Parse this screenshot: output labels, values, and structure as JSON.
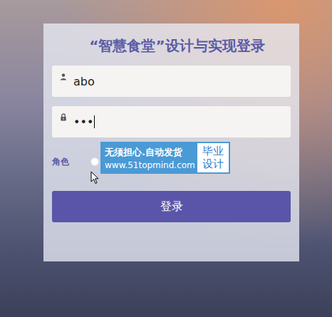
{
  "title": "“智慧食堂”设计与实现登录",
  "fields": [
    {
      "kind": "text",
      "value": "abo",
      "focused": false
    },
    {
      "kind": "password",
      "value": "•••",
      "focused": true
    }
  ],
  "role": {
    "label": "角色",
    "options": [
      {
        "selected": false
      }
    ]
  },
  "login_button": "登录",
  "watermark": {
    "line1": "无须担心.自动发货",
    "line2": "www.51topmind.com",
    "badge": [
      "毕业",
      "设计"
    ]
  }
}
